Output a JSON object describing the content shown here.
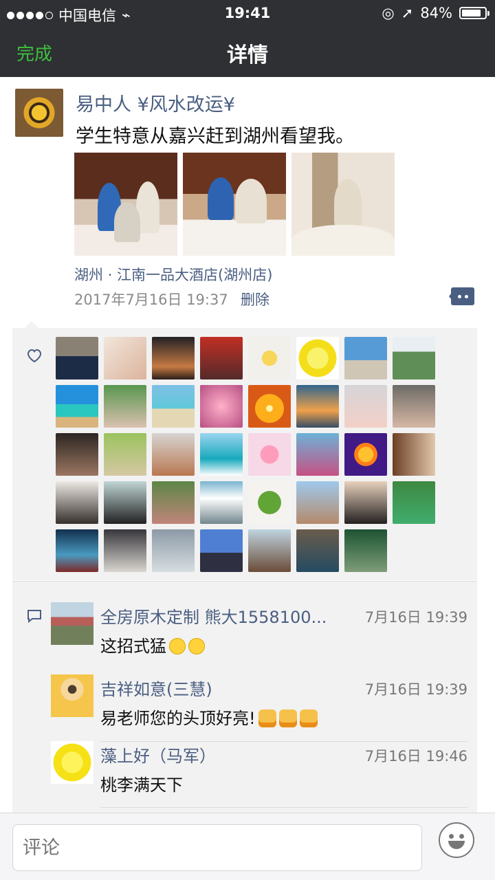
{
  "status": {
    "carrier": "中国电信",
    "time": "19:41",
    "battery": "84%"
  },
  "navbar": {
    "done": "完成",
    "title": "详情"
  },
  "post": {
    "author": "易中人 ¥风水改运¥",
    "text": "学生特意从嘉兴赶到湖州看望我。",
    "location": "湖州 · 江南一品大酒店(湖州店)",
    "time": "2017年7月16日 19:37",
    "delete": "删除"
  },
  "comments": [
    {
      "name": "全房原木定制 熊大1558100...",
      "time": "7月16日 19:39",
      "text": "这招式猛"
    },
    {
      "name": "吉祥如意(三慧)",
      "time": "7月16日 19:39",
      "text": "易老师您的头顶好亮!"
    },
    {
      "name": "藻上好（马军）",
      "time": "7月16日 19:46",
      "text": "桃李满天下"
    }
  ],
  "input": {
    "placeholder": "评论"
  }
}
